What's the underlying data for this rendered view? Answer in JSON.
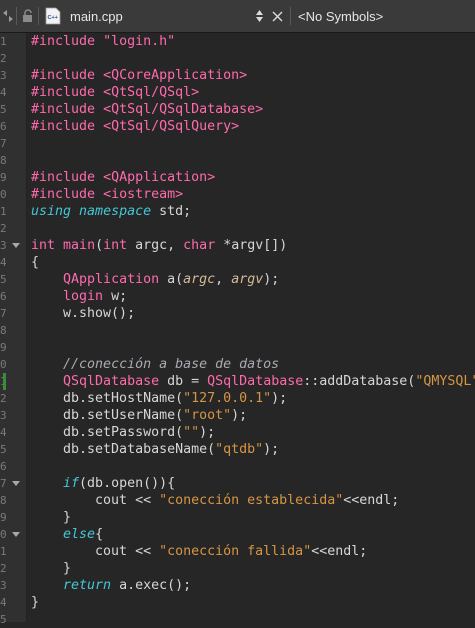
{
  "tabbar": {
    "filename": "main.cpp",
    "file_icon_text": "C++",
    "symbols": "<No Symbols>"
  },
  "code_lines": [
    {
      "tokens": [
        {
          "t": "#include ",
          "c": "prep"
        },
        {
          "t": "\"login.h\"",
          "c": "inc"
        }
      ]
    },
    {
      "tokens": []
    },
    {
      "tokens": [
        {
          "t": "#include ",
          "c": "prep"
        },
        {
          "t": "<QCoreApplication>",
          "c": "inc"
        }
      ]
    },
    {
      "tokens": [
        {
          "t": "#include ",
          "c": "prep"
        },
        {
          "t": "<QtSql/QSql>",
          "c": "inc"
        }
      ]
    },
    {
      "tokens": [
        {
          "t": "#include ",
          "c": "prep"
        },
        {
          "t": "<QtSql/QSqlDatabase>",
          "c": "inc"
        }
      ]
    },
    {
      "tokens": [
        {
          "t": "#include ",
          "c": "prep"
        },
        {
          "t": "<QtSql/QSqlQuery>",
          "c": "inc"
        }
      ]
    },
    {
      "tokens": []
    },
    {
      "tokens": []
    },
    {
      "tokens": [
        {
          "t": "#include ",
          "c": "prep"
        },
        {
          "t": "<QApplication>",
          "c": "inc"
        }
      ]
    },
    {
      "tokens": [
        {
          "t": "#include ",
          "c": "prep"
        },
        {
          "t": "<iostream>",
          "c": "inc"
        }
      ]
    },
    {
      "tokens": [
        {
          "t": "using",
          "c": "kw"
        },
        {
          "t": " ",
          "c": "plain"
        },
        {
          "t": "namespace",
          "c": "kw"
        },
        {
          "t": " std;",
          "c": "plain"
        }
      ]
    },
    {
      "tokens": []
    },
    {
      "tokens": [
        {
          "t": "int",
          "c": "type"
        },
        {
          "t": " ",
          "c": "plain"
        },
        {
          "t": "main",
          "c": "type"
        },
        {
          "t": "(",
          "c": "plain"
        },
        {
          "t": "int",
          "c": "type"
        },
        {
          "t": " argc, ",
          "c": "plain"
        },
        {
          "t": "char",
          "c": "type"
        },
        {
          "t": " *argv[])",
          "c": "plain"
        }
      ]
    },
    {
      "tokens": [
        {
          "t": "{",
          "c": "plain"
        }
      ]
    },
    {
      "tokens": [
        {
          "t": "    ",
          "c": "plain"
        },
        {
          "t": "QApplication",
          "c": "type"
        },
        {
          "t": " a(",
          "c": "plain"
        },
        {
          "t": "argc",
          "c": "param"
        },
        {
          "t": ", ",
          "c": "plain"
        },
        {
          "t": "argv",
          "c": "param"
        },
        {
          "t": ");",
          "c": "plain"
        }
      ]
    },
    {
      "tokens": [
        {
          "t": "    ",
          "c": "plain"
        },
        {
          "t": "login",
          "c": "type"
        },
        {
          "t": " w;",
          "c": "plain"
        }
      ]
    },
    {
      "tokens": [
        {
          "t": "    w.show();",
          "c": "plain"
        }
      ]
    },
    {
      "tokens": []
    },
    {
      "tokens": []
    },
    {
      "tokens": [
        {
          "t": "    ",
          "c": "plain"
        },
        {
          "t": "//conección a base de datos",
          "c": "comment"
        }
      ]
    },
    {
      "tokens": [
        {
          "t": "    ",
          "c": "plain"
        },
        {
          "t": "QSqlDatabase",
          "c": "type"
        },
        {
          "t": " db = ",
          "c": "plain"
        },
        {
          "t": "QSqlDatabase",
          "c": "type"
        },
        {
          "t": "::addDatabase(",
          "c": "plain"
        },
        {
          "t": "\"QMYSQL\"",
          "c": "str"
        },
        {
          "t": ");",
          "c": "plain"
        }
      ]
    },
    {
      "tokens": [
        {
          "t": "    db.setHostName(",
          "c": "plain"
        },
        {
          "t": "\"127.0.0.1\"",
          "c": "str"
        },
        {
          "t": ");",
          "c": "plain"
        }
      ]
    },
    {
      "tokens": [
        {
          "t": "    db.setUserName(",
          "c": "plain"
        },
        {
          "t": "\"root\"",
          "c": "str"
        },
        {
          "t": ");",
          "c": "plain"
        }
      ]
    },
    {
      "tokens": [
        {
          "t": "    db.setPassword(",
          "c": "plain"
        },
        {
          "t": "\"\"",
          "c": "str"
        },
        {
          "t": ");",
          "c": "plain"
        }
      ]
    },
    {
      "tokens": [
        {
          "t": "    db.setDatabaseName(",
          "c": "plain"
        },
        {
          "t": "\"qtdb\"",
          "c": "str"
        },
        {
          "t": ");",
          "c": "plain"
        }
      ]
    },
    {
      "tokens": []
    },
    {
      "tokens": [
        {
          "t": "    ",
          "c": "plain"
        },
        {
          "t": "if",
          "c": "kw"
        },
        {
          "t": "(db.open()){",
          "c": "plain"
        }
      ]
    },
    {
      "tokens": [
        {
          "t": "        cout << ",
          "c": "plain"
        },
        {
          "t": "\"conección establecida\"",
          "c": "str"
        },
        {
          "t": "<<endl;",
          "c": "plain"
        }
      ]
    },
    {
      "tokens": [
        {
          "t": "    }",
          "c": "plain"
        }
      ]
    },
    {
      "tokens": [
        {
          "t": "    ",
          "c": "plain"
        },
        {
          "t": "else",
          "c": "kw"
        },
        {
          "t": "{",
          "c": "plain"
        }
      ]
    },
    {
      "tokens": [
        {
          "t": "        cout << ",
          "c": "plain"
        },
        {
          "t": "\"conección fallida\"",
          "c": "str"
        },
        {
          "t": "<<endl;",
          "c": "plain"
        }
      ]
    },
    {
      "tokens": [
        {
          "t": "    }",
          "c": "plain"
        }
      ]
    },
    {
      "tokens": [
        {
          "t": "    ",
          "c": "plain"
        },
        {
          "t": "return",
          "c": "kw"
        },
        {
          "t": " a.exec();",
          "c": "plain"
        }
      ]
    },
    {
      "tokens": [
        {
          "t": "}",
          "c": "plain"
        }
      ]
    }
  ],
  "gutter": {
    "line_numbers": [
      "1",
      "2",
      "3",
      "4",
      "5",
      "6",
      "7",
      "8",
      "9",
      "0",
      "1",
      "2",
      "3",
      "4",
      "5",
      "6",
      "7",
      "8",
      "9",
      "0",
      "1",
      "2",
      "3",
      "4",
      "5",
      "6",
      "7",
      "8",
      "9",
      "0",
      "1",
      "2",
      "3",
      "4",
      "5"
    ],
    "fold_markers": [
      12,
      26,
      29
    ],
    "modified_lines": [
      20
    ]
  },
  "colors": {
    "background": "#262626",
    "preprocessor": "#ff6aad",
    "keyword": "#45c6d6",
    "string": "#d69545",
    "comment": "#a8abb0",
    "text": "#d6d6d6"
  }
}
